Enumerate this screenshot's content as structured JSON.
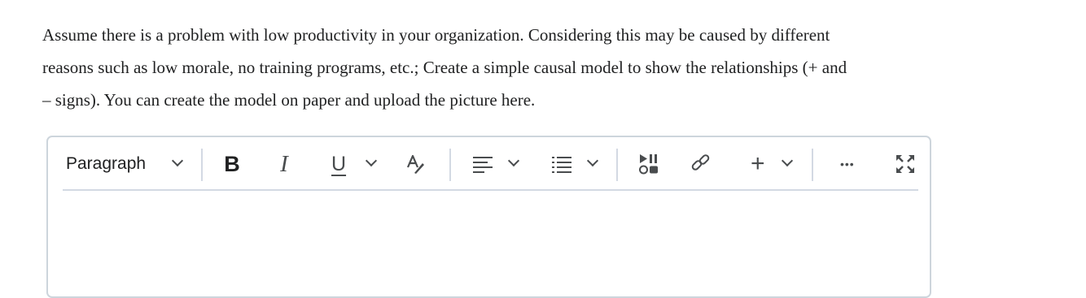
{
  "question": {
    "lines": [
      "Assume there is a problem with low productivity in your organization. Considering this may be caused by different",
      "reasons such as low morale, no training programs, etc.; Create a simple causal model to show the relationships (+ and",
      "– signs). You can create the model on paper and upload the picture here."
    ]
  },
  "toolbar": {
    "format_select": "Paragraph",
    "bold_label": "B",
    "italic_label": "I",
    "underline_label": "U",
    "insert_label": "+",
    "more_label": "•••",
    "icons": {
      "format": "chevron-down-icon",
      "strikethrough_color": "text-color-icon",
      "align": "align-left-icon",
      "list": "bullet-list-icon",
      "media": "insert-media-icon",
      "link": "link-icon",
      "fullscreen": "fullscreen-icon"
    }
  },
  "colors": {
    "text": "#202122",
    "icon": "#494c4e",
    "border": "#cdd5dc",
    "divider": "#d3d9e3"
  }
}
